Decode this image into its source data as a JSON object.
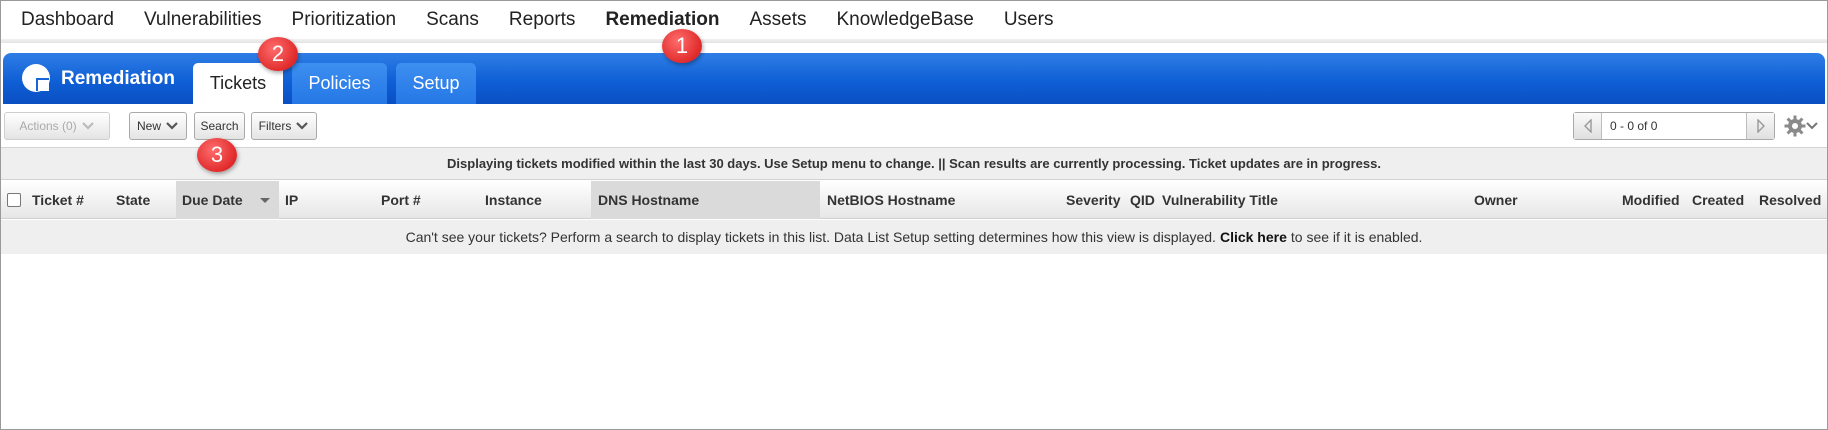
{
  "nav": {
    "items": [
      {
        "label": "Dashboard",
        "active": false
      },
      {
        "label": "Vulnerabilities",
        "active": false
      },
      {
        "label": "Prioritization",
        "active": false
      },
      {
        "label": "Scans",
        "active": false
      },
      {
        "label": "Reports",
        "active": false
      },
      {
        "label": "Remediation",
        "active": true
      },
      {
        "label": "Assets",
        "active": false
      },
      {
        "label": "KnowledgeBase",
        "active": false
      },
      {
        "label": "Users",
        "active": false
      }
    ]
  },
  "module": {
    "title": "Remediation",
    "icon": "pie-chart-icon",
    "tabs": [
      {
        "label": "Tickets",
        "selected": true
      },
      {
        "label": "Policies",
        "selected": false
      },
      {
        "label": "Setup",
        "selected": false
      }
    ]
  },
  "toolbar": {
    "actions_label": "Actions (0)",
    "new_label": "New",
    "search_label": "Search",
    "filters_label": "Filters",
    "pager_text": "0 - 0 of 0"
  },
  "message": "Displaying tickets modified within the last 30 days. Use Setup menu to change. || Scan results are currently processing. Ticket updates are in progress.",
  "table": {
    "columns": [
      "Ticket #",
      "State",
      "Due Date",
      "IP",
      "Port #",
      "Instance",
      "DNS Hostname",
      "NetBIOS Hostname",
      "Severity",
      "QID",
      "Vulnerability Title",
      "Owner",
      "Modified",
      "Created",
      "Resolved"
    ],
    "sorted_column": "Due Date",
    "empty_text_before": "Can't see your tickets? Perform a search to display tickets in this list. Data List Setup setting determines how this view is displayed.",
    "empty_link": "Click here",
    "empty_text_after": "to see if it is enabled."
  },
  "callouts": [
    "1",
    "2",
    "3"
  ],
  "colors": {
    "module_bar": "#0f5fd6",
    "tab_inactive": "#2577e6",
    "callout": "#e02a2a"
  }
}
